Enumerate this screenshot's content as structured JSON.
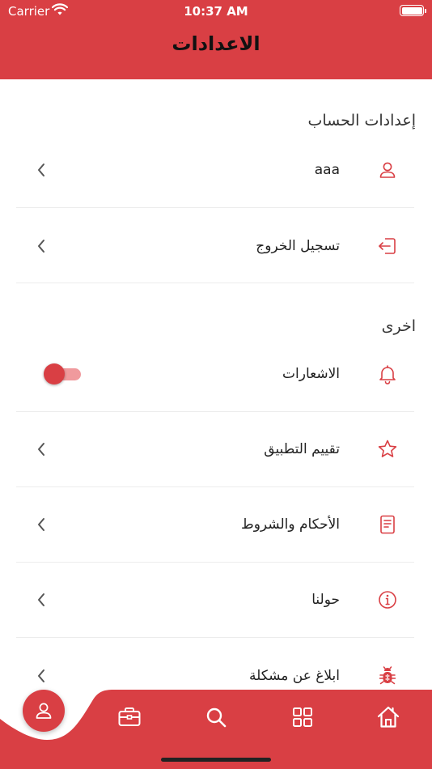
{
  "status_bar": {
    "carrier": "Carrier",
    "time": "10:37 AM"
  },
  "header": {
    "title": "الاعدادات"
  },
  "account_section": {
    "title": "إعدادات الحساب",
    "items": [
      {
        "label": "aaa",
        "icon": "user-icon"
      },
      {
        "label": "تسجيل الخروج",
        "icon": "logout-icon"
      }
    ]
  },
  "other_section": {
    "title": "اخرى",
    "items": [
      {
        "label": "الاشعارات",
        "icon": "bell-icon",
        "toggle_on": false
      },
      {
        "label": "تقييم التطبيق",
        "icon": "star-icon"
      },
      {
        "label": "الأحكام والشروط",
        "icon": "document-icon"
      },
      {
        "label": "حولنا",
        "icon": "info-icon"
      },
      {
        "label": "ابلاغ عن مشكلة",
        "icon": "bug-icon"
      }
    ]
  },
  "tab_bar": {
    "items": [
      "profile-icon",
      "briefcase-icon",
      "search-icon",
      "grid-icon",
      "home-icon"
    ],
    "active": "profile-icon"
  },
  "colors": {
    "accent": "#d93f44",
    "accent_light": "#f09a9d",
    "background": "#ffffff"
  }
}
